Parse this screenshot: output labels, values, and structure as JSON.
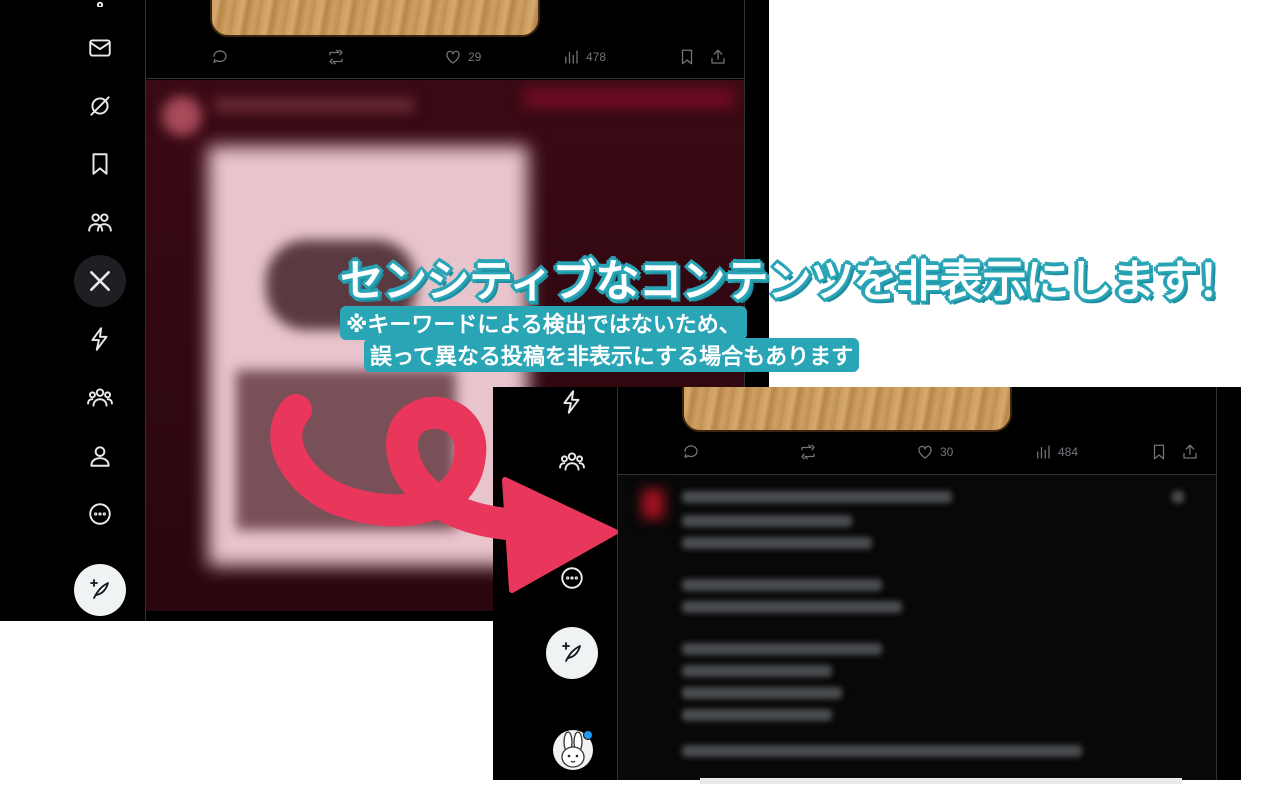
{
  "overlay": {
    "headline": "センシティブなコンテンツを非表示にします！",
    "note_line1": "※キーワードによる検出ではないため、",
    "note_line2": "誤って異なる投稿を非表示にする場合もあります"
  },
  "back_panel": {
    "stats": {
      "replies": "",
      "reposts": "",
      "likes": "29",
      "views": "478"
    },
    "nav_icons": [
      "mail-icon",
      "grok-icon",
      "bookmark-icon",
      "communities-icon",
      "x-logo-icon",
      "lightning-icon",
      "people-icon",
      "profile-icon",
      "more-icon"
    ]
  },
  "front_panel": {
    "stats": {
      "replies": "",
      "reposts": "",
      "likes": "30",
      "views": "484"
    },
    "nav_icons": [
      "lightning-icon",
      "people-icon",
      "more-icon"
    ]
  },
  "colors": {
    "accent": "#2aa5b6",
    "arrow": "#e8375a",
    "background": "#000000"
  }
}
